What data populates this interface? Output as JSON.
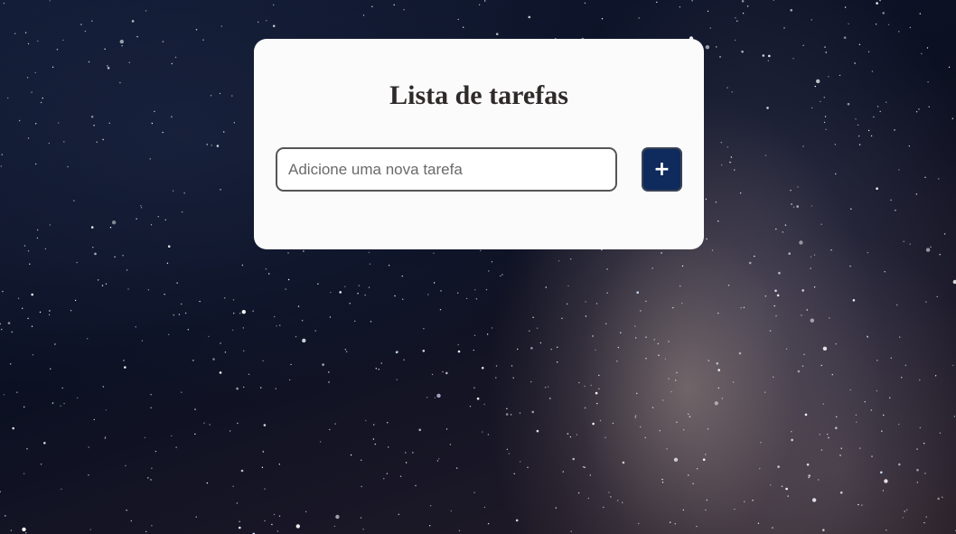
{
  "background": {
    "description_icon": "starry-night-sky",
    "colors": {
      "sky_dark": "#0d1224",
      "milky_way": "#aa968c"
    }
  },
  "card": {
    "title": "Lista de tarefas",
    "input": {
      "value": "",
      "placeholder": "Adicione uma nova tarefa"
    },
    "add_button": {
      "label": "+",
      "icon": "plus-icon",
      "color": "#0f2a5c"
    },
    "colors": {
      "card_bg": "#fcfbfc",
      "title_text": "#2f2a2a"
    }
  }
}
